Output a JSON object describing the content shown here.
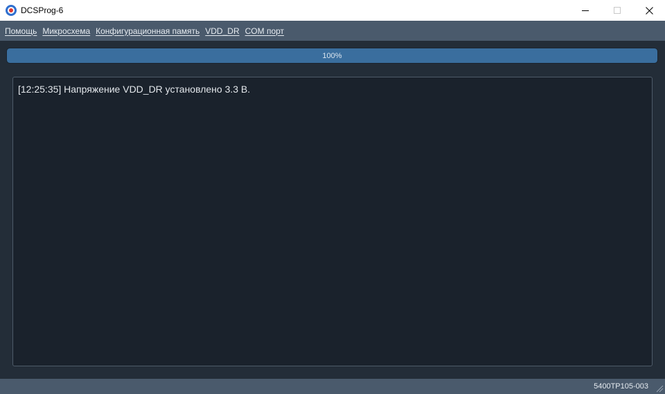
{
  "window": {
    "title": "DCSProg-6",
    "controls": {
      "minimize_icon": "minimize-icon",
      "maximize_icon": "maximize-icon",
      "close_icon": "close-icon"
    }
  },
  "menu": {
    "items": [
      {
        "label": "Помощь"
      },
      {
        "label": "Микросхема"
      },
      {
        "label": "Конфигурационная память"
      },
      {
        "label": "VDD_DR"
      },
      {
        "label": "COM порт"
      }
    ]
  },
  "progress": {
    "value_percent": 100,
    "label": "100%"
  },
  "log": {
    "lines": [
      "[12:25:35] Напряжение VDD_DR установлено 3.3 В."
    ]
  },
  "status": {
    "device": "5400ТР105-003"
  },
  "colors": {
    "background": "#232d38",
    "menubar": "#4a5a6c",
    "progress_fill": "#3a6e9e",
    "log_background": "#1a222c"
  }
}
